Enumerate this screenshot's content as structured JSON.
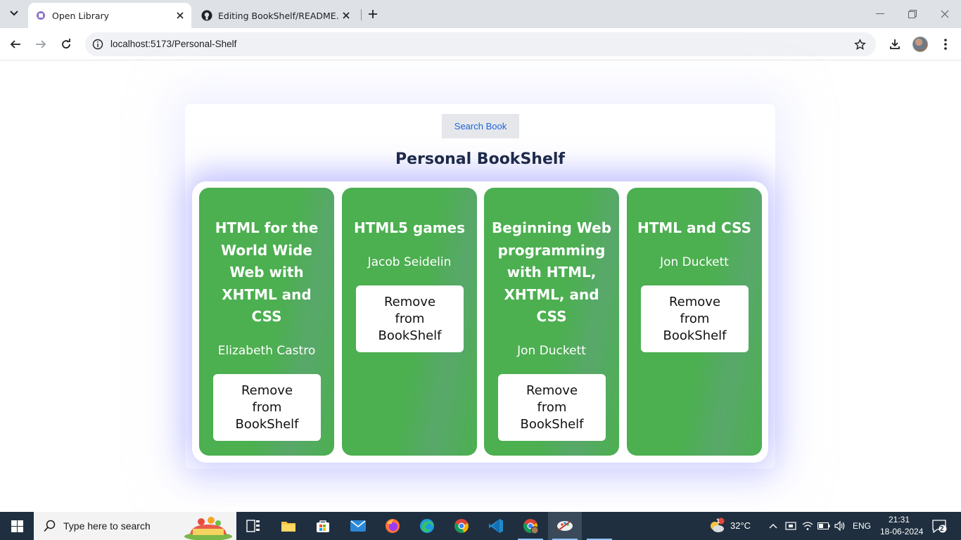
{
  "browser": {
    "tabs": [
      {
        "title": "Open Library",
        "active": true
      },
      {
        "title": "Editing BookShelf/README.md",
        "active": false
      }
    ],
    "url": "localhost:5173/Personal-Shelf"
  },
  "page": {
    "search_button_label": "Search Book",
    "title": "Personal BookShelf",
    "books": [
      {
        "title": "HTML for the World Wide Web with XHTML and CSS",
        "author": "Elizabeth Castro",
        "button": "Remove from BookShelf"
      },
      {
        "title": "HTML5 games",
        "author": "Jacob Seidelin",
        "button": "Remove from BookShelf"
      },
      {
        "title": "Beginning Web programming with HTML, XHTML, and CSS",
        "author": "Jon Duckett",
        "button": "Remove from BookShelf"
      },
      {
        "title": "HTML and CSS",
        "author": "Jon Duckett",
        "button": "Remove from BookShelf"
      }
    ],
    "colors": {
      "card": "#4caf50",
      "title": "#1e2a4a",
      "search_text": "#1d64d8"
    }
  },
  "taskbar": {
    "search_placeholder": "Type here to search",
    "weather": "32°C",
    "weather_badge": "1",
    "language": "ENG",
    "time": "21:31",
    "date": "18-06-2024",
    "notifications": "2",
    "apps": [
      "task-view-icon",
      "file-explorer-icon",
      "microsoft-store-icon",
      "mail-icon",
      "firefox-icon",
      "edge-icon",
      "chrome-icon",
      "vscode-icon",
      "chrome-profile-icon",
      "paint-app-icon"
    ]
  }
}
